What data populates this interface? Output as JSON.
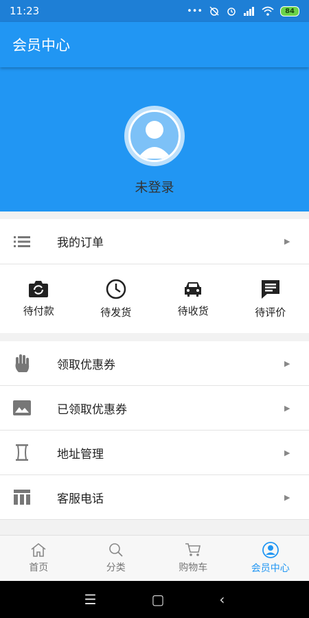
{
  "status_bar": {
    "time": "11:23",
    "battery": "84"
  },
  "app_bar": {
    "title": "会员中心"
  },
  "profile": {
    "login_status": "未登录"
  },
  "orders": {
    "label": "我的订单"
  },
  "order_status": [
    {
      "label": "待付款",
      "icon": "camera-icon"
    },
    {
      "label": "待发货",
      "icon": "clock-icon"
    },
    {
      "label": "待收货",
      "icon": "car-icon"
    },
    {
      "label": "待评价",
      "icon": "comment-icon"
    }
  ],
  "menu": [
    {
      "label": "领取优惠券",
      "icon": "hand-icon"
    },
    {
      "label": "已领取优惠券",
      "icon": "image-icon"
    },
    {
      "label": "地址管理",
      "icon": "hourglass-icon"
    },
    {
      "label": "客服电话",
      "icon": "table-icon"
    }
  ],
  "bottom_nav": [
    {
      "label": "首页",
      "icon": "home-icon"
    },
    {
      "label": "分类",
      "icon": "search-icon"
    },
    {
      "label": "购物车",
      "icon": "cart-icon"
    },
    {
      "label": "会员中心",
      "icon": "user-icon",
      "active": true
    }
  ],
  "colors": {
    "primary": "#2196f3",
    "status_bar": "#1e7fd6"
  }
}
